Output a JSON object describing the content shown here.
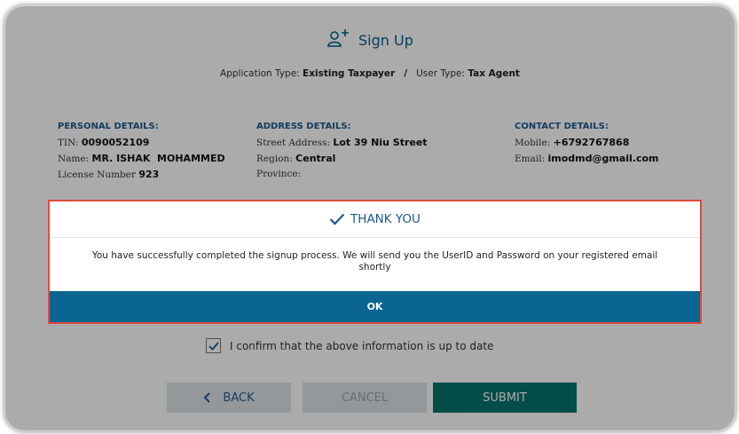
{
  "header": {
    "title": "Sign Up",
    "icon": "add-user-icon"
  },
  "application": {
    "type_label": "Application Type:",
    "type_value": "Existing Taxpayer",
    "separator": "/",
    "user_type_label": "User Type:",
    "user_type_value": "Tax Agent"
  },
  "personal": {
    "heading": "PERSONAL DETAILS:",
    "tin_label": "TIN:",
    "tin_value": "0090052109",
    "name_label": "Name:",
    "name_value": "MR. ISHAK  MOHAMMED",
    "license_label": "License Number",
    "license_value": "923"
  },
  "address": {
    "heading": "ADDRESS DETAILS:",
    "street_label": "Street Address:",
    "street_value": "Lot 39 Niu Street",
    "region_label": "Region:",
    "region_value": "Central",
    "province_label": "Province:"
  },
  "contact": {
    "heading": "CONTACT DETAILS:",
    "mobile_label": "Mobile:",
    "mobile_value": "+6792767868",
    "email_label": "Email:",
    "email_value": "imodmd@gmail.com"
  },
  "modal": {
    "title": "THANK YOU",
    "message": "You have successfully completed the signup process. We will send you the UserID and Password on your registered email shortly",
    "ok_label": "OK"
  },
  "confirm": {
    "label": "I confirm that the above information is up to date",
    "checked": true
  },
  "buttons": {
    "back": "BACK",
    "cancel": "CANCEL",
    "submit": "SUBMIT"
  },
  "colors": {
    "accent": "#0b6592",
    "submit": "#07736d",
    "modal_border": "#e04a3c"
  }
}
